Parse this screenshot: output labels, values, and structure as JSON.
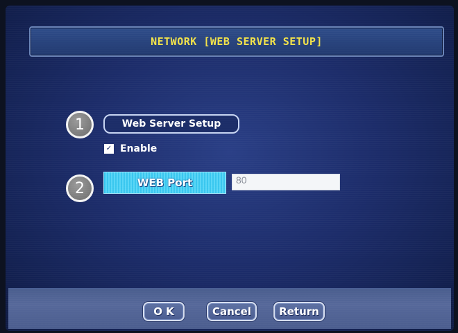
{
  "dialog": {
    "title": "NETWORK [WEB SERVER SETUP]"
  },
  "markers": {
    "one": "1",
    "two": "2"
  },
  "web_server": {
    "section_label": "Web Server Setup",
    "enable_label": "Enable",
    "enable_checked": true
  },
  "web_port": {
    "label": "WEB Port",
    "value": "80"
  },
  "buttons": {
    "ok": "O K",
    "cancel": "Cancel",
    "return": "Return"
  },
  "colors": {
    "title_text": "#f2e24a",
    "screen_bg": "#1d2d6b",
    "port_label_bg": "#39c7ef"
  }
}
